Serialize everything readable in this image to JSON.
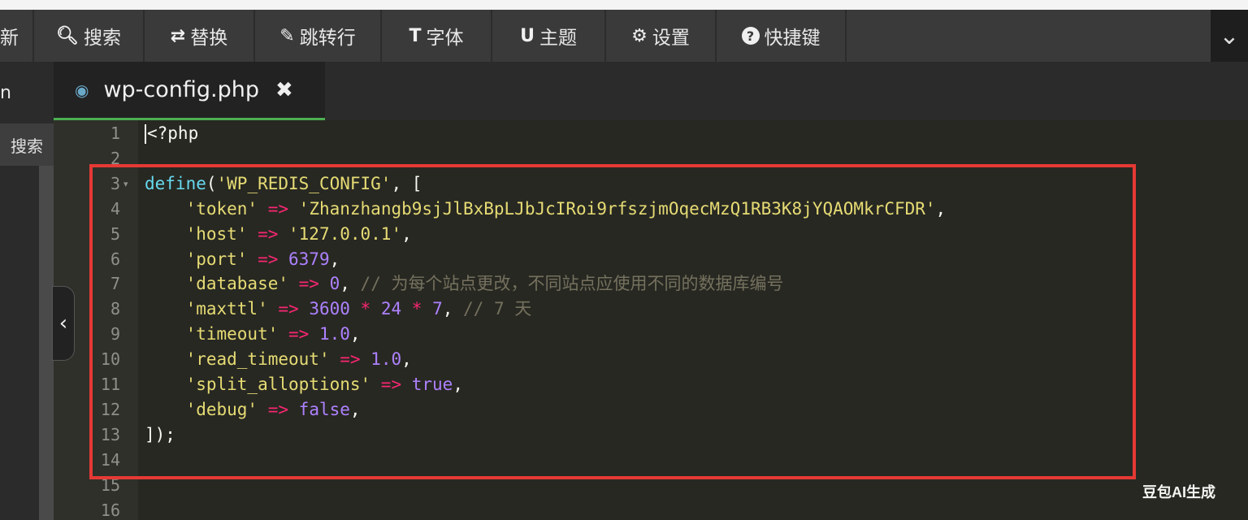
{
  "toolbar": {
    "items": [
      {
        "label": "新",
        "icon": ""
      },
      {
        "label": "搜索",
        "icon": "search-icon"
      },
      {
        "label": "替换",
        "icon": "replace-icon"
      },
      {
        "label": "跳转行",
        "icon": "pin-icon"
      },
      {
        "label": "字体",
        "icon": "font-icon"
      },
      {
        "label": "主题",
        "icon": "theme-icon"
      },
      {
        "label": "设置",
        "icon": "gear-icon"
      },
      {
        "label": "快捷键",
        "icon": "help-icon"
      }
    ],
    "collapse_icon": "chevron-down-icon"
  },
  "sidebar": {
    "top_label": "n",
    "search_label": "搜索",
    "toggle_icon": "chevron-left-icon"
  },
  "tab": {
    "filename": "wp-config.php",
    "icon": "php-elephant-icon",
    "close_icon": "close-icon"
  },
  "editor": {
    "line_numbers": [
      "1",
      "2",
      "3",
      "4",
      "5",
      "6",
      "7",
      "8",
      "9",
      "10",
      "11",
      "12",
      "13",
      "14",
      "15",
      "16"
    ],
    "lines": [
      [
        {
          "t": "<?php",
          "c": "plain"
        }
      ],
      [],
      [
        {
          "t": "define",
          "c": "fn"
        },
        {
          "t": "(",
          "c": "plain"
        },
        {
          "t": "'WP_REDIS_CONFIG'",
          "c": "str"
        },
        {
          "t": ", [",
          "c": "plain"
        }
      ],
      [
        {
          "t": "    ",
          "c": "plain"
        },
        {
          "t": "'token'",
          "c": "str"
        },
        {
          "t": " => ",
          "c": "op"
        },
        {
          "t": "'Zhanzhangb9sjJlBxBpLJbJcIRoi9rfszjmOqecMzQ1RB3K8jYQAOMkrCFDR'",
          "c": "str"
        },
        {
          "t": ",",
          "c": "plain"
        }
      ],
      [
        {
          "t": "    ",
          "c": "plain"
        },
        {
          "t": "'host'",
          "c": "str"
        },
        {
          "t": " => ",
          "c": "op"
        },
        {
          "t": "'127.0.0.1'",
          "c": "str"
        },
        {
          "t": ",",
          "c": "plain"
        }
      ],
      [
        {
          "t": "    ",
          "c": "plain"
        },
        {
          "t": "'port'",
          "c": "str"
        },
        {
          "t": " => ",
          "c": "op"
        },
        {
          "t": "6379",
          "c": "num"
        },
        {
          "t": ",",
          "c": "plain"
        }
      ],
      [
        {
          "t": "    ",
          "c": "plain"
        },
        {
          "t": "'database'",
          "c": "str"
        },
        {
          "t": " => ",
          "c": "op"
        },
        {
          "t": "0",
          "c": "num"
        },
        {
          "t": ", ",
          "c": "plain"
        },
        {
          "t": "// 为每个站点更改，不同站点应使用不同的数据库编号",
          "c": "cmt"
        }
      ],
      [
        {
          "t": "    ",
          "c": "plain"
        },
        {
          "t": "'maxttl'",
          "c": "str"
        },
        {
          "t": " => ",
          "c": "op"
        },
        {
          "t": "3600",
          "c": "num"
        },
        {
          "t": " * ",
          "c": "op"
        },
        {
          "t": "24",
          "c": "num"
        },
        {
          "t": " * ",
          "c": "op"
        },
        {
          "t": "7",
          "c": "num"
        },
        {
          "t": ", ",
          "c": "plain"
        },
        {
          "t": "// 7 天",
          "c": "cmt"
        }
      ],
      [
        {
          "t": "    ",
          "c": "plain"
        },
        {
          "t": "'timeout'",
          "c": "str"
        },
        {
          "t": " => ",
          "c": "op"
        },
        {
          "t": "1.0",
          "c": "num"
        },
        {
          "t": ",",
          "c": "plain"
        }
      ],
      [
        {
          "t": "    ",
          "c": "plain"
        },
        {
          "t": "'read_timeout'",
          "c": "str"
        },
        {
          "t": " => ",
          "c": "op"
        },
        {
          "t": "1.0",
          "c": "num"
        },
        {
          "t": ",",
          "c": "plain"
        }
      ],
      [
        {
          "t": "    ",
          "c": "plain"
        },
        {
          "t": "'split_alloptions'",
          "c": "str"
        },
        {
          "t": " => ",
          "c": "op"
        },
        {
          "t": "true",
          "c": "num"
        },
        {
          "t": ",",
          "c": "plain"
        }
      ],
      [
        {
          "t": "    ",
          "c": "plain"
        },
        {
          "t": "'debug'",
          "c": "str"
        },
        {
          "t": " => ",
          "c": "op"
        },
        {
          "t": "false",
          "c": "num"
        },
        {
          "t": ",",
          "c": "plain"
        }
      ],
      [
        {
          "t": "]);",
          "c": "plain"
        }
      ],
      [],
      [],
      []
    ],
    "fold_line": 3
  },
  "watermark": "豆包AI生成",
  "colors": {
    "highlight_box": "#e53935",
    "active_tab_underline": "#4caf50"
  }
}
